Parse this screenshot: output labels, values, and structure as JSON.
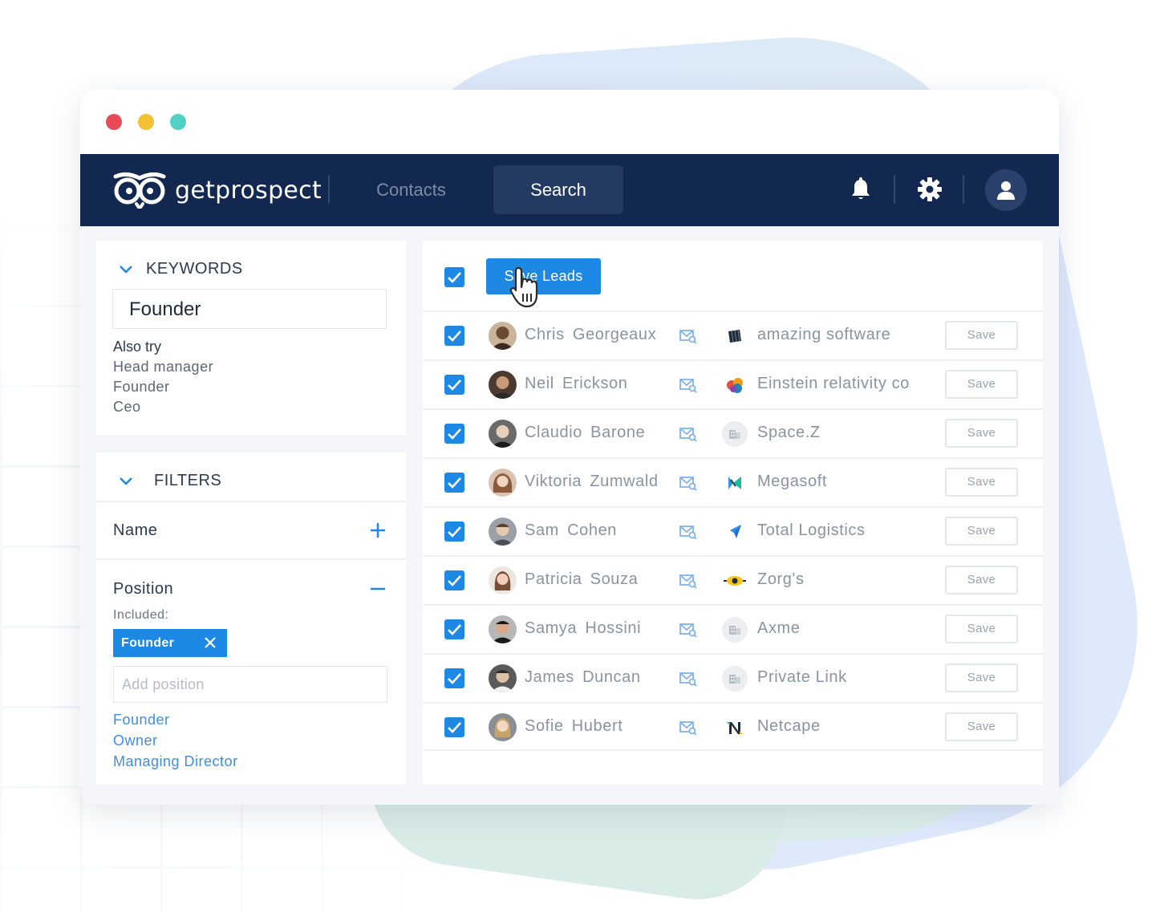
{
  "app": {
    "brand": "getprospect",
    "colors": {
      "navbar": "#132850",
      "accent": "#1e88e5",
      "red_dot": "#e84b56",
      "yellow_dot": "#f3c132",
      "teal_dot": "#4fd1c5"
    }
  },
  "nav": {
    "contacts_label": "Contacts",
    "search_label": "Search",
    "icons": [
      "bell-icon",
      "gear-icon",
      "user-icon"
    ]
  },
  "keywords": {
    "title": "KEYWORDS",
    "value": "Founder",
    "also_try_label": "Also try",
    "suggestions": [
      "Head manager",
      "Founder",
      "Ceo"
    ]
  },
  "filters": {
    "title": "FILTERS",
    "name_label": "Name",
    "position_label": "Position",
    "included_label": "Included:",
    "tag": "Founder",
    "add_placeholder": "Add position",
    "suggestions": [
      "Founder",
      "Owner",
      "Managing Director"
    ]
  },
  "results": {
    "save_leads_label": "Save Leads",
    "save_label": "Save",
    "rows": [
      {
        "name": "Chris Georgeaux",
        "company": "amazing software"
      },
      {
        "name": "Neil Erickson",
        "company": "Einstein relativity co"
      },
      {
        "name": "Claudio Barone",
        "company": "Space.Z"
      },
      {
        "name": "Viktoria Zumwald",
        "company": "Megasoft"
      },
      {
        "name": "Sam Cohen",
        "company": "Total Logistics"
      },
      {
        "name": "Patricia Souza",
        "company": "Zorg's"
      },
      {
        "name": "Samya Hossini",
        "company": "Axme"
      },
      {
        "name": "James Duncan",
        "company": "Private Link"
      },
      {
        "name": "Sofie Hubert",
        "company": "Netcape"
      }
    ]
  }
}
